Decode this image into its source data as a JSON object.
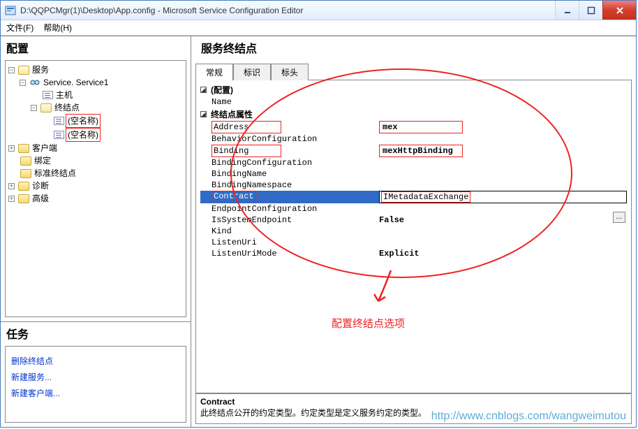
{
  "window": {
    "title": "D:\\QQPCMgr(1)\\Desktop\\App.config - Microsoft Service Configuration Editor"
  },
  "menu": {
    "file": "文件(F)",
    "help": "帮助(H)"
  },
  "left_header": "配置",
  "tree": {
    "services": "服务",
    "service1": "Service. Service1",
    "host": "主机",
    "endpoints": "终结点",
    "ep1": "(空名称)",
    "ep2": "(空名称)",
    "client": "客户端",
    "binding": "绑定",
    "std_ep": "标准终结点",
    "diag": "诊断",
    "adv": "高级"
  },
  "tasks": {
    "header": "任务",
    "delete_ep": "删除终结点",
    "new_service": "新建服务...",
    "new_client": "新建客户端..."
  },
  "right_header": "服务终结点",
  "tabs": {
    "general": "常规",
    "identity": "标识",
    "headers": "标头"
  },
  "groups": {
    "config": "(配置)",
    "ep_attr": "终结点属性"
  },
  "props": {
    "name": "Name",
    "address": "Address",
    "address_val": "mex",
    "behavior_cfg": "BehaviorConfiguration",
    "binding": "Binding",
    "binding_val": "mexHttpBinding",
    "binding_cfg": "BindingConfiguration",
    "binding_name": "BindingName",
    "binding_ns": "BindingNamespace",
    "contract": "Contract",
    "contract_val": "IMetadataExchange",
    "endpoint_cfg": "EndpointConfiguration",
    "is_sys": "IsSystemEndpoint",
    "is_sys_val": "False",
    "kind": "Kind",
    "listen_uri": "ListenUri",
    "listen_mode": "ListenUriMode",
    "listen_mode_val": "Explicit"
  },
  "desc": {
    "name": "Contract",
    "text": "此终结点公开的约定类型。约定类型是定义服务约定的类型。"
  },
  "annotation": "配置终结点选项",
  "watermark": "http://www.cnblogs.com/wangweimutou"
}
